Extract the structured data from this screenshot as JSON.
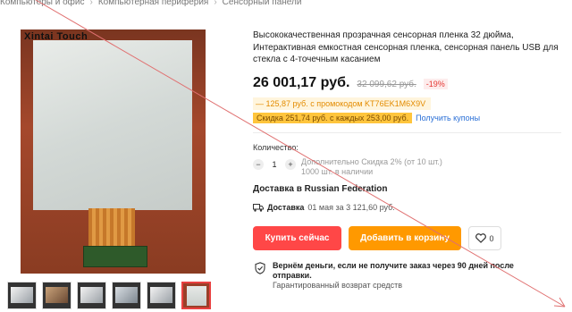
{
  "breadcrumb": [
    "Компьютеры и офис",
    "Компьютерная периферия",
    "Сенсорный панели"
  ],
  "product": {
    "brand_on_image": "Xintai Touch",
    "title": "Высококачественная прозрачная сенсорная пленка 32 дюйма, Интерактивная емкостная сенсорная пленка, сенсорная панель USB для стекла с 4-точечным касанием",
    "price": "26 001,17 руб.",
    "old_price": "32 099,62 руб.",
    "discount": "-19%",
    "promo": "— 125,87 руб. с промокодом KT76EK1M6X9V",
    "coupon": "Скидка 251,74 руб. с каждых 253,00 руб.",
    "coupon_link": "Получить купоны"
  },
  "quantity": {
    "label": "Количество:",
    "minus": "−",
    "plus": "+",
    "value": "1",
    "extra_discount": "Дополнительно Скидка 2% (от 10 шт.)",
    "stock": "1000 шт. в наличии"
  },
  "delivery": {
    "title": "Доставка в Russian Federation",
    "label": "Доставка",
    "text": "01 мая за 3 121,60 руб."
  },
  "actions": {
    "buy_now": "Купить сейчас",
    "add_to_cart": "Добавить в корзину",
    "wishlist_count": "0"
  },
  "guarantee": {
    "headline": "Вернём деньги, если не получите заказ через 90 дней после отправки.",
    "sub": "Гарантированный возврат средств"
  },
  "thumbnails": [
    "thumb-1",
    "thumb-2",
    "thumb-3",
    "thumb-4",
    "thumb-5",
    "thumb-6"
  ],
  "colors": {
    "buy": "#ff4747",
    "cart": "#ff9900",
    "coupon": "#ffc53d",
    "discount": "#e53935"
  }
}
